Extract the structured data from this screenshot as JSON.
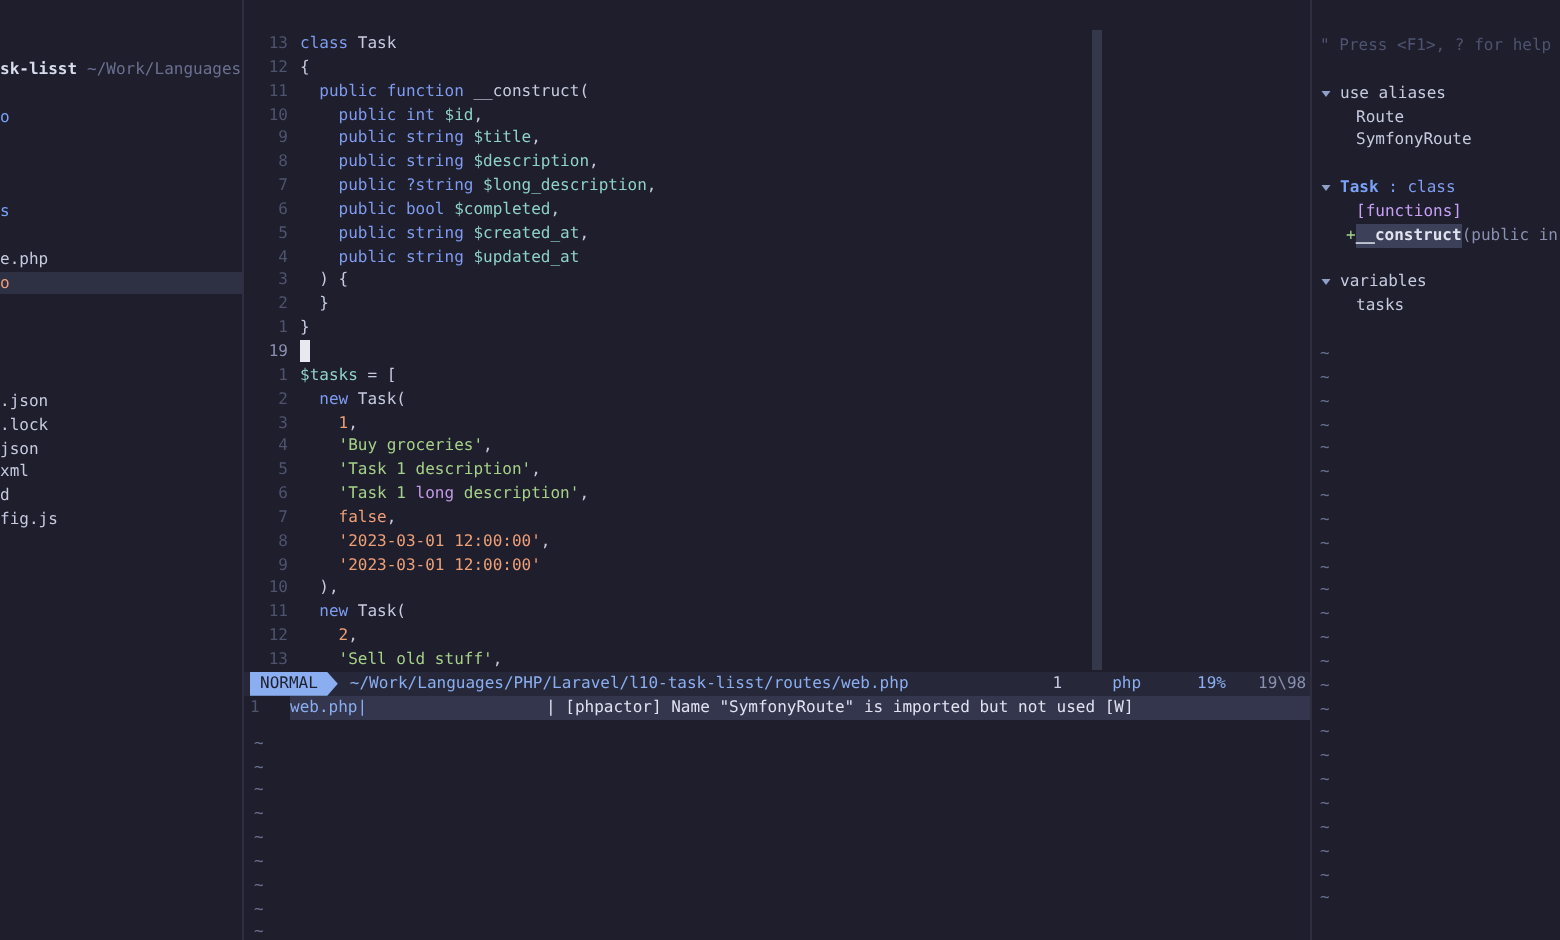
{
  "sidebar": {
    "header": {
      "name": "sk-lisst",
      "path": "~/Work/Languages"
    },
    "groups": [
      [
        {
          "label": "o",
          "kind": "dir",
          "selected": false
        }
      ],
      [
        {
          "label": "s",
          "kind": "dir",
          "selected": false
        }
      ],
      [
        {
          "label": "e.php",
          "kind": "file",
          "selected": false
        },
        {
          "label": "o",
          "kind": "modified",
          "selected": true
        }
      ],
      [
        {
          "label": ".json",
          "kind": "file",
          "selected": false
        },
        {
          "label": ".lock",
          "kind": "file",
          "selected": false
        },
        {
          "label": "json",
          "kind": "file",
          "selected": false
        },
        {
          "label": "xml",
          "kind": "file",
          "selected": false
        },
        {
          "label": "d",
          "kind": "file",
          "selected": false
        },
        {
          "label": "fig.js",
          "kind": "file",
          "selected": false
        }
      ]
    ]
  },
  "editor": {
    "lines": [
      {
        "number": "13",
        "current": false,
        "tokens": [
          {
            "kind": "keyword",
            "text": "class"
          },
          {
            "kind": "plain",
            "text": " Task"
          }
        ]
      },
      {
        "number": "12",
        "current": false,
        "tokens": [
          {
            "kind": "plain",
            "text": "{"
          }
        ]
      },
      {
        "number": "11",
        "current": false,
        "tokens": [
          {
            "kind": "keyword",
            "text": "  public function"
          },
          {
            "kind": "plain",
            "text": " __construct("
          }
        ]
      },
      {
        "number": "10",
        "current": false,
        "tokens": [
          {
            "kind": "keyword",
            "text": "    public int"
          },
          {
            "kind": "variable",
            "text": " $id"
          },
          {
            "kind": "plain",
            "text": ","
          }
        ]
      },
      {
        "number": "9",
        "current": false,
        "tokens": [
          {
            "kind": "keyword",
            "text": "    public string"
          },
          {
            "kind": "variable",
            "text": " $title"
          },
          {
            "kind": "plain",
            "text": ","
          }
        ]
      },
      {
        "number": "8",
        "current": false,
        "tokens": [
          {
            "kind": "keyword",
            "text": "    public string"
          },
          {
            "kind": "variable",
            "text": " $description"
          },
          {
            "kind": "plain",
            "text": ","
          }
        ]
      },
      {
        "number": "7",
        "current": false,
        "tokens": [
          {
            "kind": "keyword",
            "text": "    public ?string"
          },
          {
            "kind": "variable",
            "text": " $long_description"
          },
          {
            "kind": "plain",
            "text": ","
          }
        ]
      },
      {
        "number": "6",
        "current": false,
        "tokens": [
          {
            "kind": "keyword",
            "text": "    public bool"
          },
          {
            "kind": "variable",
            "text": " $completed"
          },
          {
            "kind": "plain",
            "text": ","
          }
        ]
      },
      {
        "number": "5",
        "current": false,
        "tokens": [
          {
            "kind": "keyword",
            "text": "    public string"
          },
          {
            "kind": "variable",
            "text": " $created_at"
          },
          {
            "kind": "plain",
            "text": ","
          }
        ]
      },
      {
        "number": "4",
        "current": false,
        "tokens": [
          {
            "kind": "keyword",
            "text": "    public string"
          },
          {
            "kind": "variable",
            "text": " $updated_at"
          }
        ]
      },
      {
        "number": "3",
        "current": false,
        "tokens": [
          {
            "kind": "plain",
            "text": "  ) {"
          }
        ]
      },
      {
        "number": "2",
        "current": false,
        "tokens": [
          {
            "kind": "plain",
            "text": "  }"
          }
        ]
      },
      {
        "number": "1",
        "current": false,
        "tokens": [
          {
            "kind": "plain",
            "text": "}"
          }
        ]
      },
      {
        "number": "19",
        "current": true
      },
      {
        "number": "1",
        "current": false,
        "tokens": [
          {
            "kind": "variable",
            "text": "$tasks"
          },
          {
            "kind": "plain",
            "text": " = ["
          }
        ]
      },
      {
        "number": "2",
        "current": false,
        "tokens": [
          {
            "kind": "keyword",
            "text": "  new"
          },
          {
            "kind": "plain",
            "text": " Task("
          }
        ]
      },
      {
        "number": "3",
        "current": false,
        "tokens": [
          {
            "kind": "number",
            "text": "    1"
          },
          {
            "kind": "plain",
            "text": ","
          }
        ]
      },
      {
        "number": "4",
        "current": false,
        "tokens": [
          {
            "kind": "string",
            "text": "    'Buy groceries'"
          },
          {
            "kind": "plain",
            "text": ","
          }
        ]
      },
      {
        "number": "5",
        "current": false,
        "tokens": [
          {
            "kind": "string",
            "text": "    'Task 1 description'"
          },
          {
            "kind": "plain",
            "text": ","
          }
        ]
      },
      {
        "number": "6",
        "current": false,
        "tokens": [
          {
            "kind": "string",
            "text": "    'Task 1 "
          },
          {
            "kind": "misspelled",
            "text": "long"
          },
          {
            "kind": "string",
            "text": " description'"
          },
          {
            "kind": "plain",
            "text": ","
          }
        ]
      },
      {
        "number": "7",
        "current": false,
        "tokens": [
          {
            "kind": "number",
            "text": "    false"
          },
          {
            "kind": "plain",
            "text": ","
          }
        ]
      },
      {
        "number": "8",
        "current": false,
        "tokens": [
          {
            "kind": "number",
            "text": "    '2023-03-01 12:00:00'"
          },
          {
            "kind": "plain",
            "text": ","
          }
        ]
      },
      {
        "number": "9",
        "current": false,
        "tokens": [
          {
            "kind": "number",
            "text": "    '2023-03-01 12:00:00'"
          }
        ]
      },
      {
        "number": "10",
        "current": false,
        "tokens": [
          {
            "kind": "plain",
            "text": "  ),"
          }
        ]
      },
      {
        "number": "11",
        "current": false,
        "tokens": [
          {
            "kind": "keyword",
            "text": "  new"
          },
          {
            "kind": "plain",
            "text": " Task("
          }
        ]
      },
      {
        "number": "12",
        "current": false,
        "tokens": [
          {
            "kind": "number",
            "text": "    2"
          },
          {
            "kind": "plain",
            "text": ","
          }
        ]
      },
      {
        "number": "13",
        "current": false,
        "tokens": [
          {
            "kind": "string",
            "text": "    'Sell old stuff'"
          },
          {
            "kind": "plain",
            "text": ","
          }
        ]
      }
    ]
  },
  "status_bar": {
    "mode": "NORMAL",
    "path": "~/Work/Languages/PHP/Laravel/l10-task-lisst/routes/web.php",
    "diagnostics": "1",
    "filetype": "php",
    "percent": "19%",
    "position": "19\\98"
  },
  "message_line": {
    "number": "1",
    "input": "web.php|",
    "message": "| [phpactor] Name \"SymfonyRoute\" is imported but not used [W]"
  },
  "editor_filler": [
    "~",
    "~",
    "~",
    "~",
    "~",
    "~",
    "~",
    "~",
    "~"
  ],
  "outline": {
    "help": "\" Press <F1>, ? for help",
    "sections": [
      {
        "label": "use aliases",
        "expanded": true,
        "children": [
          {
            "label": "Route",
            "kind": "symbol",
            "selected": false
          },
          {
            "label": "SymfonyRoute",
            "kind": "symbol",
            "selected": false
          }
        ]
      },
      {
        "label": "Task",
        "suffix": " : class",
        "expanded": true,
        "children": [
          {
            "label": "[functions]",
            "kind": "category",
            "selected": false
          },
          {
            "label": "__construct",
            "marker": "+",
            "detail": "(public in",
            "kind": "method",
            "selected": true
          }
        ]
      },
      {
        "label": "variables",
        "expanded": true,
        "children": [
          {
            "label": "tasks",
            "kind": "symbol",
            "selected": false
          }
        ]
      }
    ],
    "filler": [
      "~",
      "~",
      "~",
      "~",
      "~",
      "~",
      "~",
      "~",
      "~",
      "~",
      "~",
      "~",
      "~",
      "~",
      "~",
      "~",
      "~",
      "~",
      "~",
      "~",
      "~",
      "~",
      "~",
      "~"
    ]
  }
}
